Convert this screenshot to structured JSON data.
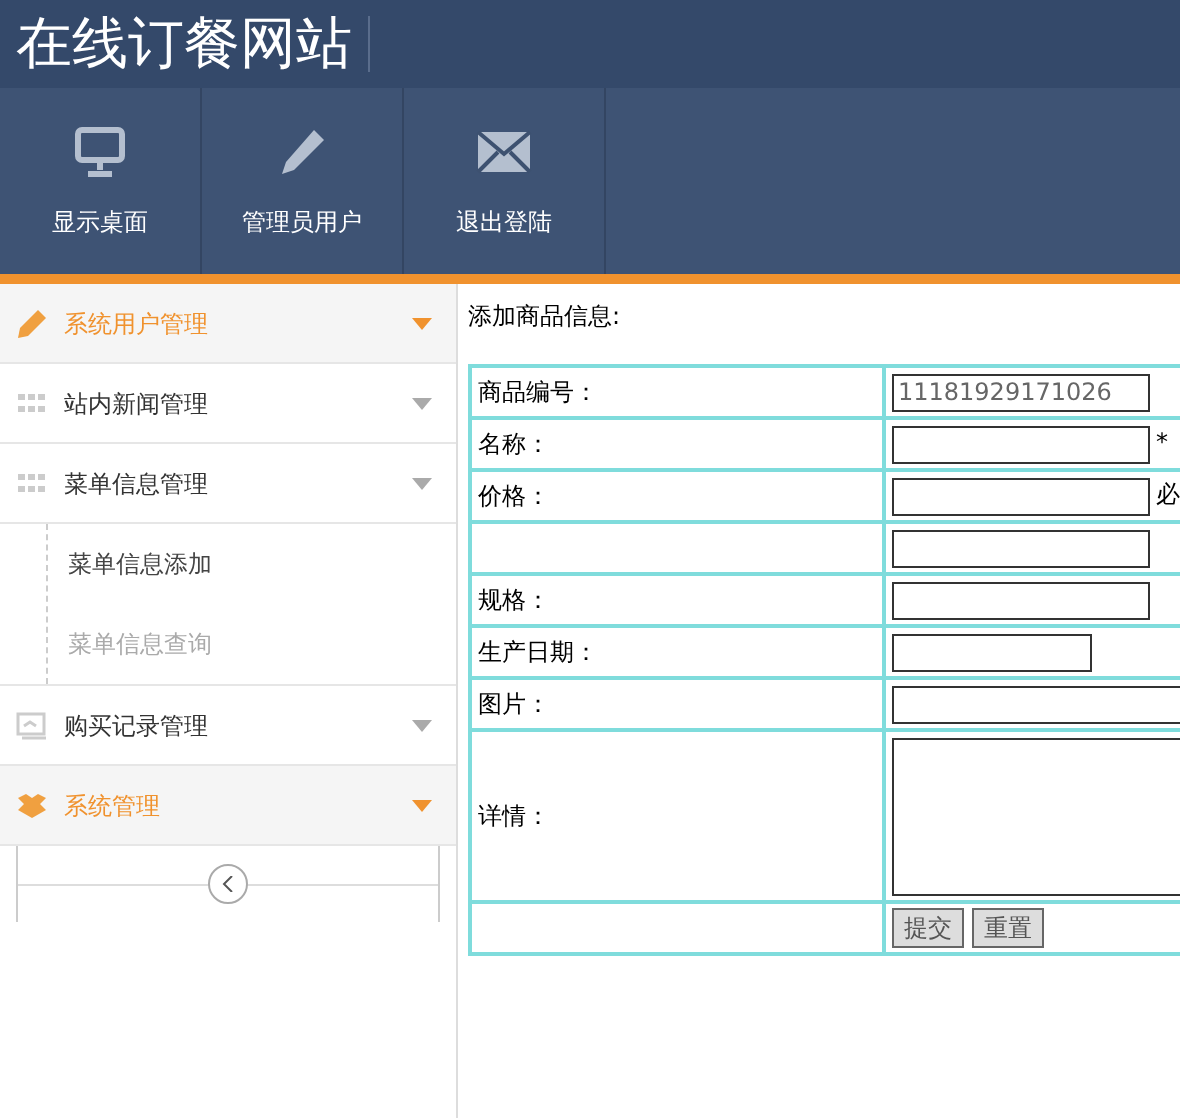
{
  "site_title": "在线订餐网站",
  "nav": [
    {
      "label": "显示桌面",
      "kind": "monitor"
    },
    {
      "label": "管理员用户",
      "kind": "pencil"
    },
    {
      "label": "退出登陆",
      "kind": "envelope"
    }
  ],
  "sidebar": {
    "items": [
      {
        "label": "系统用户管理",
        "kind": "pencil",
        "highlighted": true
      },
      {
        "label": "站内新闻管理",
        "kind": "grid",
        "highlighted": false
      },
      {
        "label": "菜单信息管理",
        "kind": "grid",
        "highlighted": false,
        "children": [
          {
            "label": "菜单信息添加",
            "selected": true
          },
          {
            "label": "菜单信息查询",
            "selected": false
          }
        ]
      },
      {
        "label": "购买记录管理",
        "kind": "screen",
        "highlighted": false
      },
      {
        "label": "系统管理",
        "kind": "box",
        "highlighted": true
      }
    ]
  },
  "form": {
    "title": "添加商品信息:",
    "rows": [
      {
        "kind": "input",
        "label": "商品编号：",
        "value": "11181929171026"
      },
      {
        "kind": "input",
        "label": "名称：",
        "suffix": "*"
      },
      {
        "kind": "input",
        "label": "价格：",
        "suffix": "必"
      },
      {
        "kind": "input"
      },
      {
        "kind": "input",
        "label": "规格："
      },
      {
        "kind": "date",
        "label": "生产日期："
      },
      {
        "kind": "wide",
        "label": "图片："
      },
      {
        "kind": "textarea",
        "label": "详情："
      },
      {
        "kind": "buttons",
        "buttons": [
          "提交",
          "重置"
        ]
      }
    ]
  }
}
